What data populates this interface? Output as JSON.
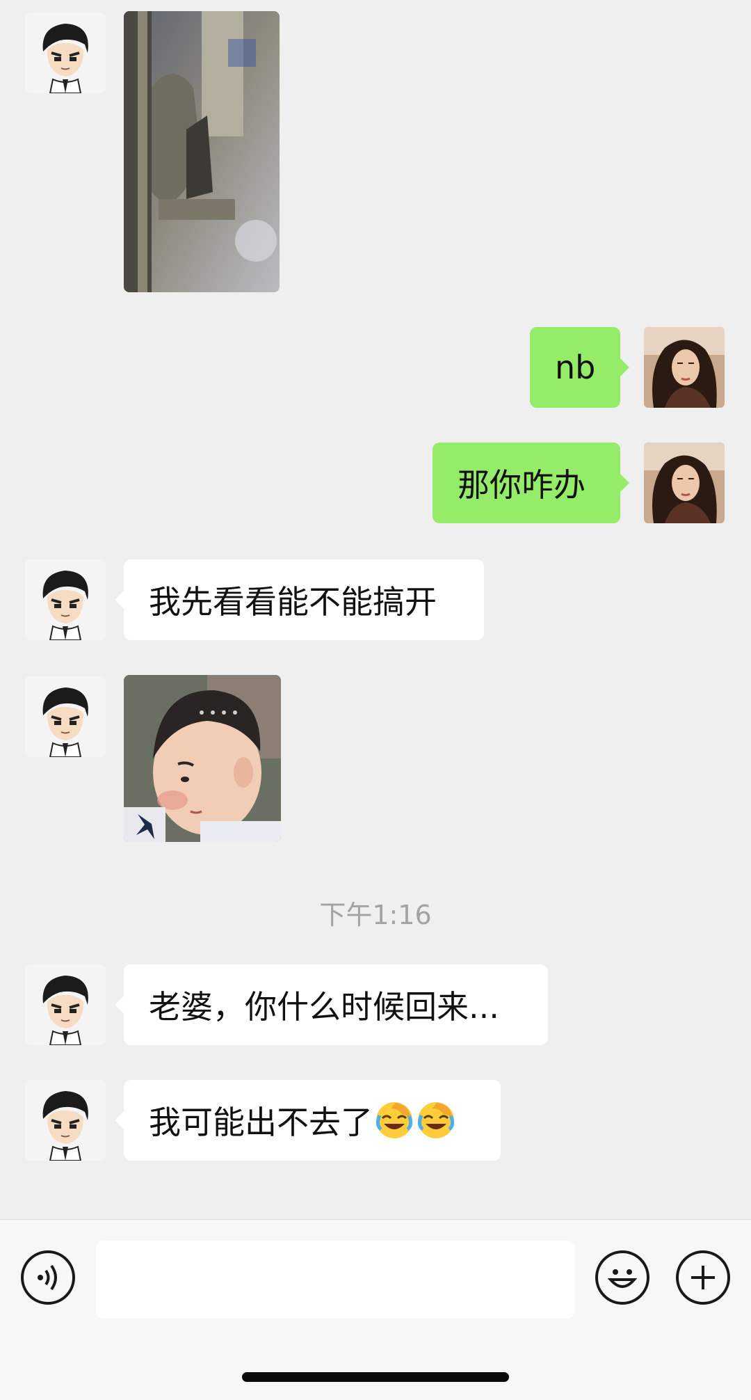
{
  "messages": [
    {
      "id": "m1",
      "side": "in",
      "kind": "image",
      "description_icon": "photo-icon"
    },
    {
      "id": "m2",
      "side": "out",
      "kind": "text",
      "text": "nb"
    },
    {
      "id": "m3",
      "side": "out",
      "kind": "text",
      "text": "那你咋办"
    },
    {
      "id": "m4",
      "side": "in",
      "kind": "text",
      "text": "我先看看能不能搞开"
    },
    {
      "id": "m5",
      "side": "in",
      "kind": "image",
      "description_icon": "sticker-icon"
    },
    {
      "id": "m6",
      "side": "in",
      "kind": "text",
      "text": "老婆，你什么时候回来..."
    },
    {
      "id": "m7",
      "side": "in",
      "kind": "text",
      "text": "我可能出不去了",
      "emoji_count": 2,
      "emoji_icon": "facepalm-laugh-emoji-icon"
    }
  ],
  "timestamp": "下午1:16",
  "input": {
    "value": "",
    "placeholder": ""
  },
  "colors": {
    "background": "#efeff0",
    "incoming_bubble": "#ffffff",
    "outgoing_bubble": "#95ec69",
    "timestamp_text": "#a3a3a3"
  },
  "icons": {
    "voice": "voice-icon",
    "emoji": "smiley-icon",
    "more": "plus-icon"
  }
}
